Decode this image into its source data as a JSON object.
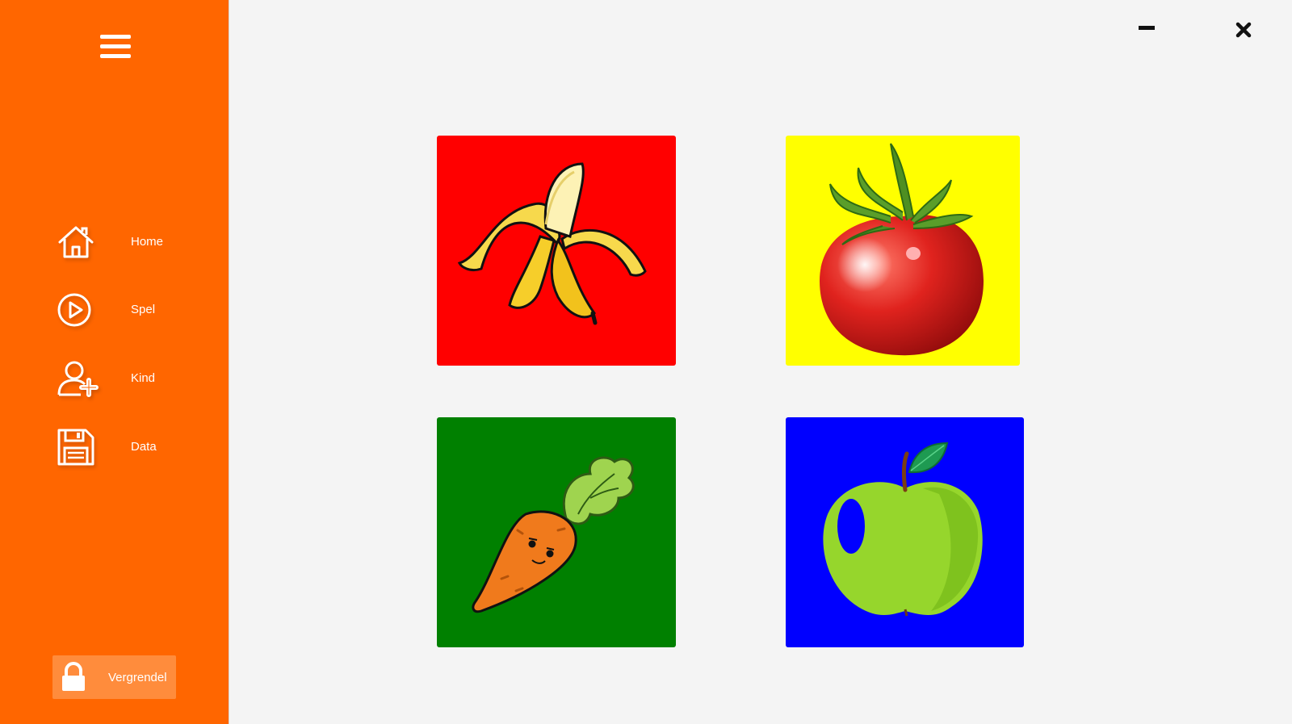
{
  "sidebar": {
    "menu_icon": "hamburger-menu-icon",
    "items": [
      {
        "label": "Home",
        "icon": "home-icon"
      },
      {
        "label": "Spel",
        "icon": "play-icon"
      },
      {
        "label": "Kind",
        "icon": "add-user-icon"
      },
      {
        "label": "Data",
        "icon": "save-icon"
      }
    ],
    "lock_button": {
      "label": "Vergrendel",
      "icon": "lock-icon"
    }
  },
  "window_controls": {
    "minimize_icon": "minimize-icon",
    "close_icon": "close-icon"
  },
  "tiles": [
    {
      "fruit": "banana",
      "color": "#ff0000"
    },
    {
      "fruit": "tomato",
      "color": "#ffff00"
    },
    {
      "fruit": "carrot",
      "color": "#008000"
    },
    {
      "fruit": "apple",
      "color": "#0000ff"
    }
  ],
  "colors": {
    "sidebar": "#ff6600",
    "background": "#f4f4f4"
  }
}
